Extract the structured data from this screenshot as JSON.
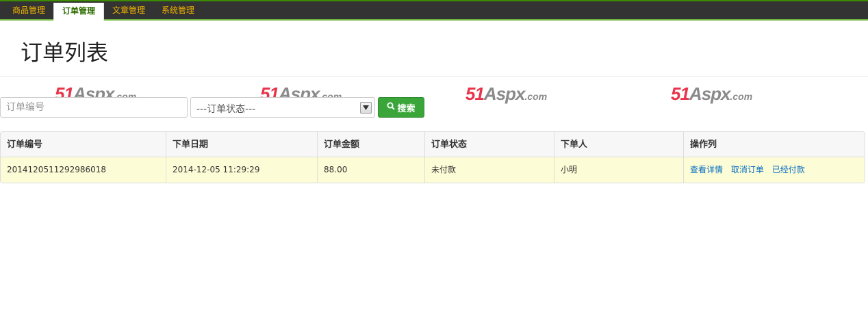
{
  "nav": {
    "items": [
      {
        "label": "商品管理",
        "active": false
      },
      {
        "label": "订单管理",
        "active": true
      },
      {
        "label": "文章管理",
        "active": false
      },
      {
        "label": "系统管理",
        "active": false
      }
    ]
  },
  "page": {
    "title": "订单列表"
  },
  "watermark": {
    "part1": "51",
    "part2": "Aspx",
    "part3": ".com"
  },
  "search": {
    "order_no_value": "",
    "order_no_placeholder": "订单编号",
    "status_selected": "---订单状态---",
    "button_label": "搜索"
  },
  "table": {
    "headers": [
      "订单编号",
      "下单日期",
      "订单金额",
      "订单状态",
      "下单人",
      "操作列"
    ],
    "rows": [
      {
        "order_no": "20141205112929860​18",
        "date": "2014-12-05 11:29:29",
        "amount": "88.00",
        "status": "未付款",
        "customer": "小明",
        "actions": [
          "查看详情",
          "取消订单",
          "已经付款"
        ]
      }
    ]
  },
  "colors": {
    "nav_bg": "#333333",
    "nav_text": "#f0b400",
    "nav_active_text": "#2e6b00",
    "search_button": "#3aa63a",
    "row_highlight": "#fcfcd6",
    "link": "#0a6fc2",
    "watermark_red": "#e8344a"
  }
}
